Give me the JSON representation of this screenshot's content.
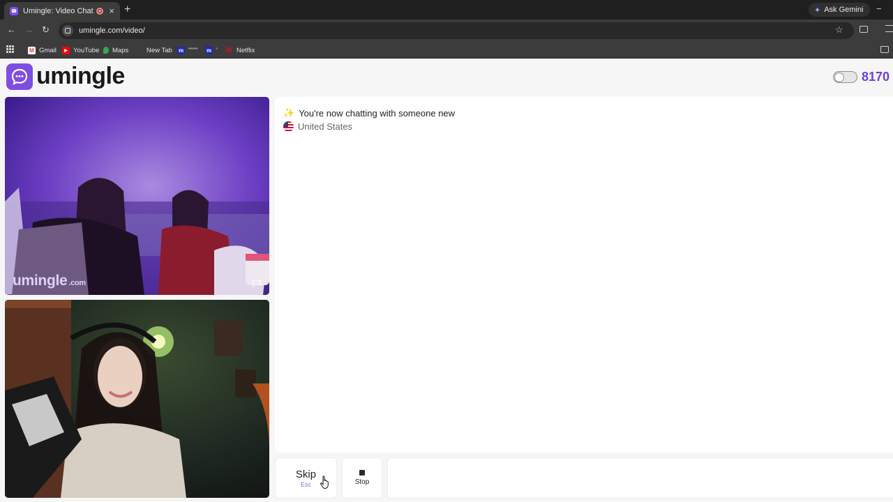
{
  "browser": {
    "tab": {
      "title": "Umingle: Video Chat with S",
      "close": "×"
    },
    "new_tab": "+",
    "ask_gemini": "Ask Gemini",
    "minimize": "−",
    "nav": {
      "back": "←",
      "forward": "→",
      "reload": "↻"
    },
    "url": "umingle.com/video/",
    "star": "☆",
    "bookmarks": [
      {
        "label": "Gmail",
        "icon": "gmail-icon",
        "color": "#ea4335"
      },
      {
        "label": "YouTube",
        "icon": "youtube-icon",
        "color": "#ff0000"
      },
      {
        "label": "Maps",
        "icon": "maps-icon",
        "color": "#34a853"
      },
      {
        "label": "New Tab",
        "icon": "",
        "color": ""
      },
      {
        "label": "\"\"\"\"",
        "icon": "m-icon",
        "color": "#1a2bb5"
      },
      {
        "label": "'",
        "icon": "m-icon",
        "color": "#1a2bb5"
      },
      {
        "label": "Netflix",
        "icon": "netflix-icon",
        "color": "#e50914"
      }
    ]
  },
  "page": {
    "logo_text": "umingle",
    "online_count": "8170",
    "remote_video": {
      "watermark_brand": "umingle",
      "watermark_suffix": ".com"
    },
    "chat": {
      "notice_icon": "✨",
      "notice": "You're now chatting with someone new",
      "country": "United States"
    },
    "controls": {
      "skip_label": "Skip",
      "skip_hint": "Esc",
      "stop_label": "Stop"
    }
  },
  "colors": {
    "brand": "#7f4de0",
    "online_count": "#6f3fd6",
    "chrome_dark": "#1f1f1f",
    "chrome_toolbar": "#3c3c3c"
  }
}
